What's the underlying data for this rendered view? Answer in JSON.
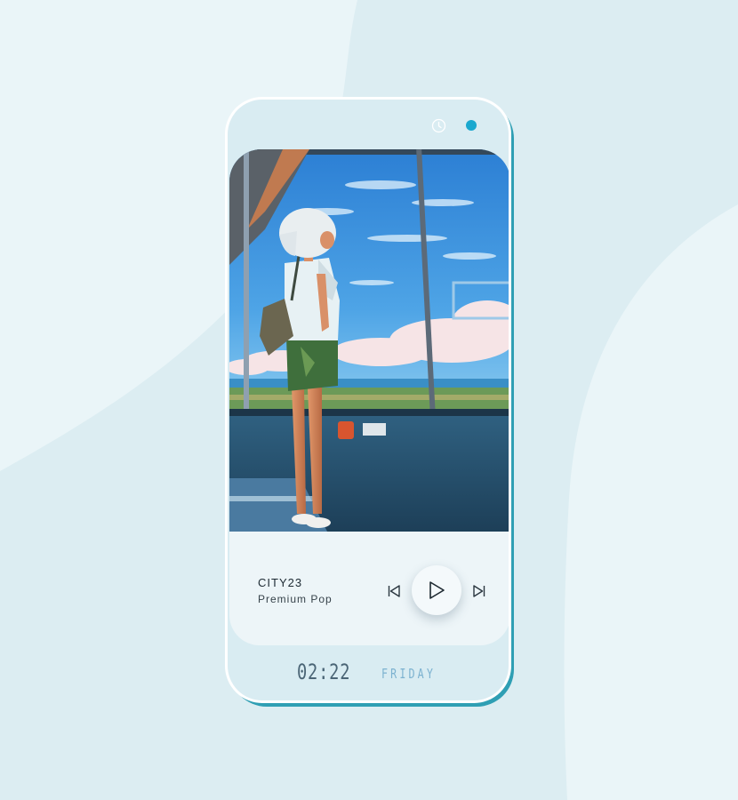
{
  "colors": {
    "background": "#dcedf2",
    "phone_accent": "#2f9fb4",
    "status_dot": "#1aa8cf",
    "day_text": "#7cb2d0"
  },
  "status_bar": {
    "icon": "clock-icon",
    "indicator": "status-dot"
  },
  "now_playing": {
    "title": "CITY23",
    "subtitle": "Premium Pop"
  },
  "controls": {
    "previous_icon": "skip-previous-icon",
    "play_icon": "play-icon",
    "next_icon": "skip-next-icon"
  },
  "footer": {
    "time": "02:22",
    "day": "FRIDAY"
  }
}
